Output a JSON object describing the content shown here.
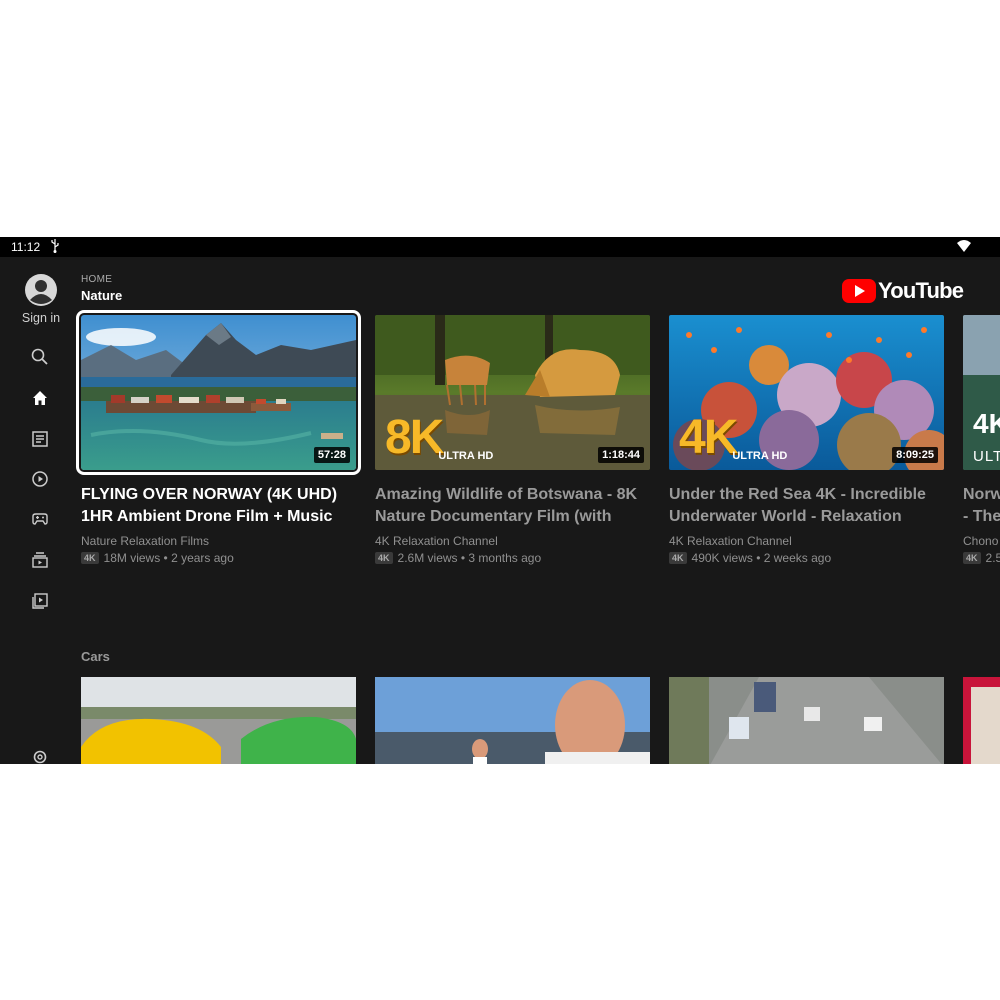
{
  "status_bar": {
    "time": "11:12"
  },
  "sidebar": {
    "sign_in_label": "Sign in",
    "items": [
      {
        "name": "search",
        "icon": "search-icon"
      },
      {
        "name": "home",
        "icon": "home-icon"
      },
      {
        "name": "subscriptions",
        "icon": "subscriptions-icon"
      },
      {
        "name": "music",
        "icon": "music-icon"
      },
      {
        "name": "gaming",
        "icon": "gamepad-icon"
      },
      {
        "name": "library",
        "icon": "library-icon"
      },
      {
        "name": "videos",
        "icon": "video-library-icon"
      },
      {
        "name": "settings",
        "icon": "gear-icon"
      }
    ]
  },
  "header": {
    "breadcrumb": "HOME",
    "section": "Nature",
    "brand": "YouTube"
  },
  "nature_row": [
    {
      "title": "FLYING OVER NORWAY (4K UHD) 1HR Ambient Drone Film + Music",
      "channel": "Nature Relaxation Films",
      "badge": "4K",
      "meta": "18M views • 2 years ago",
      "duration": "57:28"
    },
    {
      "title": "Amazing Wildlife of Botswana - 8K Nature Documentary Film (with",
      "channel": "4K Relaxation Channel",
      "badge": "4K",
      "meta": "2.6M views • 3 months ago",
      "duration": "1:18:44",
      "overlay": "8K",
      "overlay_sub": "ULTRA HD"
    },
    {
      "title": "Under the Red Sea 4K - Incredible Underwater World - Relaxation",
      "channel": "4K Relaxation Channel",
      "badge": "4K",
      "meta": "490K views • 2 weeks ago",
      "duration": "8:09:25",
      "overlay": "4K",
      "overlay_sub": "ULTRA HD"
    },
    {
      "title": "Norw - The",
      "channel": "Chono",
      "badge": "4K",
      "meta": "2.5",
      "overlay": "4K",
      "overlay_sub": "ULTI"
    }
  ],
  "cars_row": {
    "title": "Cars"
  },
  "colors": {
    "background": "#181818",
    "brand_red": "#ff0000",
    "badge_gold": "#f7b928"
  }
}
